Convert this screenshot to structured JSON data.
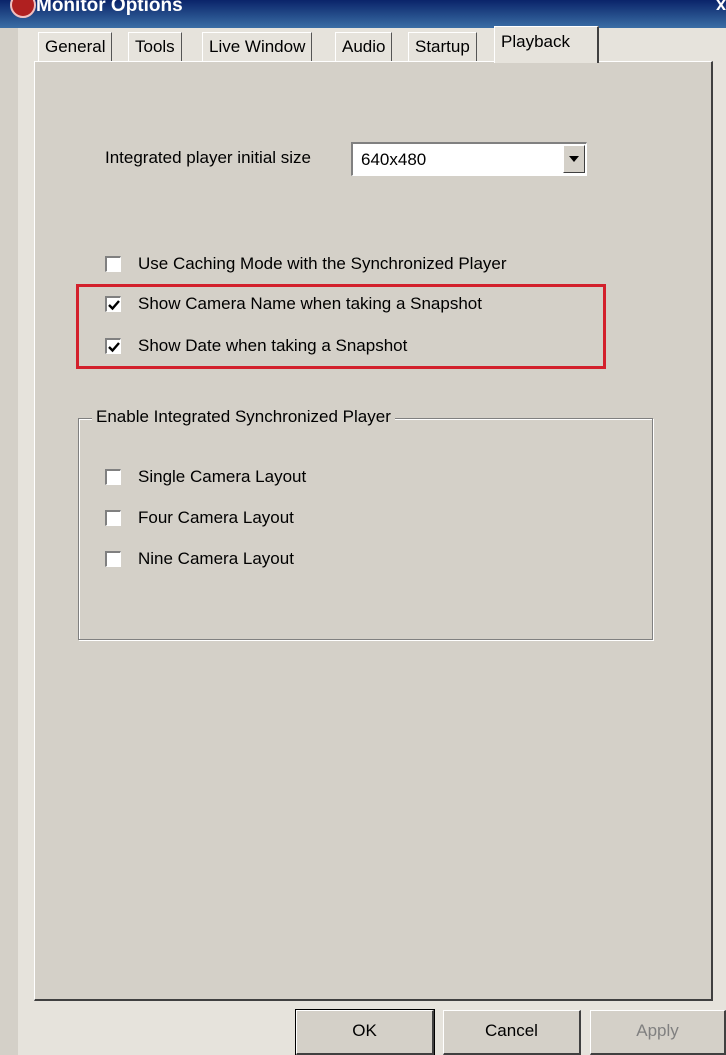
{
  "window": {
    "title": "Monitor Options",
    "close_label": "x"
  },
  "tabs": [
    {
      "label": "General",
      "active": false
    },
    {
      "label": "Tools",
      "active": false
    },
    {
      "label": "Live Window",
      "active": false
    },
    {
      "label": "Audio",
      "active": false
    },
    {
      "label": "Startup",
      "active": false
    },
    {
      "label": "Playback",
      "active": true
    }
  ],
  "playback": {
    "player_size_label": "Integrated player initial size",
    "player_size_value": "640x480",
    "options": [
      {
        "label": "Use Caching Mode with the Synchronized Player",
        "checked": false
      },
      {
        "label": "Show Camera Name when taking a Snapshot",
        "checked": true
      },
      {
        "label": "Show Date when taking a Snapshot",
        "checked": true
      }
    ],
    "group": {
      "title": "Enable Integrated Synchronized Player",
      "options": [
        {
          "label": "Single Camera Layout",
          "checked": false
        },
        {
          "label": "Four Camera Layout",
          "checked": false
        },
        {
          "label": "Nine Camera Layout",
          "checked": false
        }
      ]
    }
  },
  "buttons": {
    "ok": "OK",
    "cancel": "Cancel",
    "apply": "Apply"
  },
  "highlight_color": "#d3202c"
}
